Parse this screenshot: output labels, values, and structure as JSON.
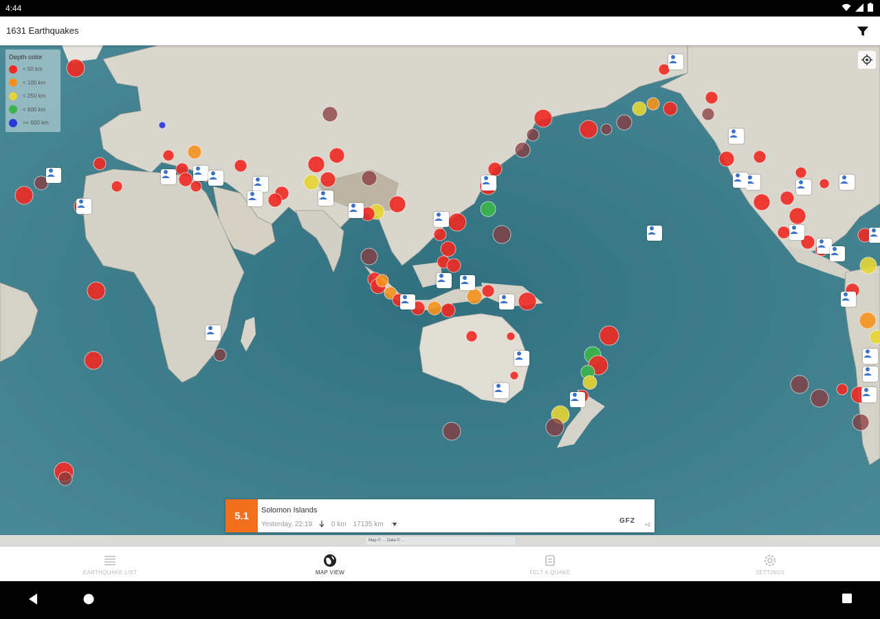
{
  "status": {
    "time": "4:44"
  },
  "appbar": {
    "title": "1631 Earthquakes",
    "filter_icon": "filter-icon"
  },
  "legend": {
    "title": "Depth color",
    "items": [
      {
        "label": "< 50 km",
        "color": "#ee2a24"
      },
      {
        "label": "< 100 km",
        "color": "#f5921e"
      },
      {
        "label": "< 250 km",
        "color": "#e6d534"
      },
      {
        "label": "< 600 km",
        "color": "#3bb54a"
      },
      {
        "label": ">= 600 km",
        "color": "#2b35d9"
      }
    ]
  },
  "selected_quake": {
    "magnitude": "5.1",
    "place": "Solomon Islands",
    "time": "Yesterday, 22:19",
    "depth": "0 km",
    "distance": "17135 km",
    "source": "GFZ",
    "more": "+2",
    "badge_color": "#f26f1e"
  },
  "attribution": "Map © … Data © …",
  "nav": {
    "tabs": [
      {
        "label": "EARTHQUAKE LIST",
        "icon": "list-icon"
      },
      {
        "label": "MAP VIEW",
        "icon": "globe-icon"
      },
      {
        "label": "FELT A QUAKE",
        "icon": "felt-icon"
      },
      {
        "label": "SETTINGS",
        "icon": "settings-icon"
      }
    ],
    "active": "MAP VIEW"
  }
}
